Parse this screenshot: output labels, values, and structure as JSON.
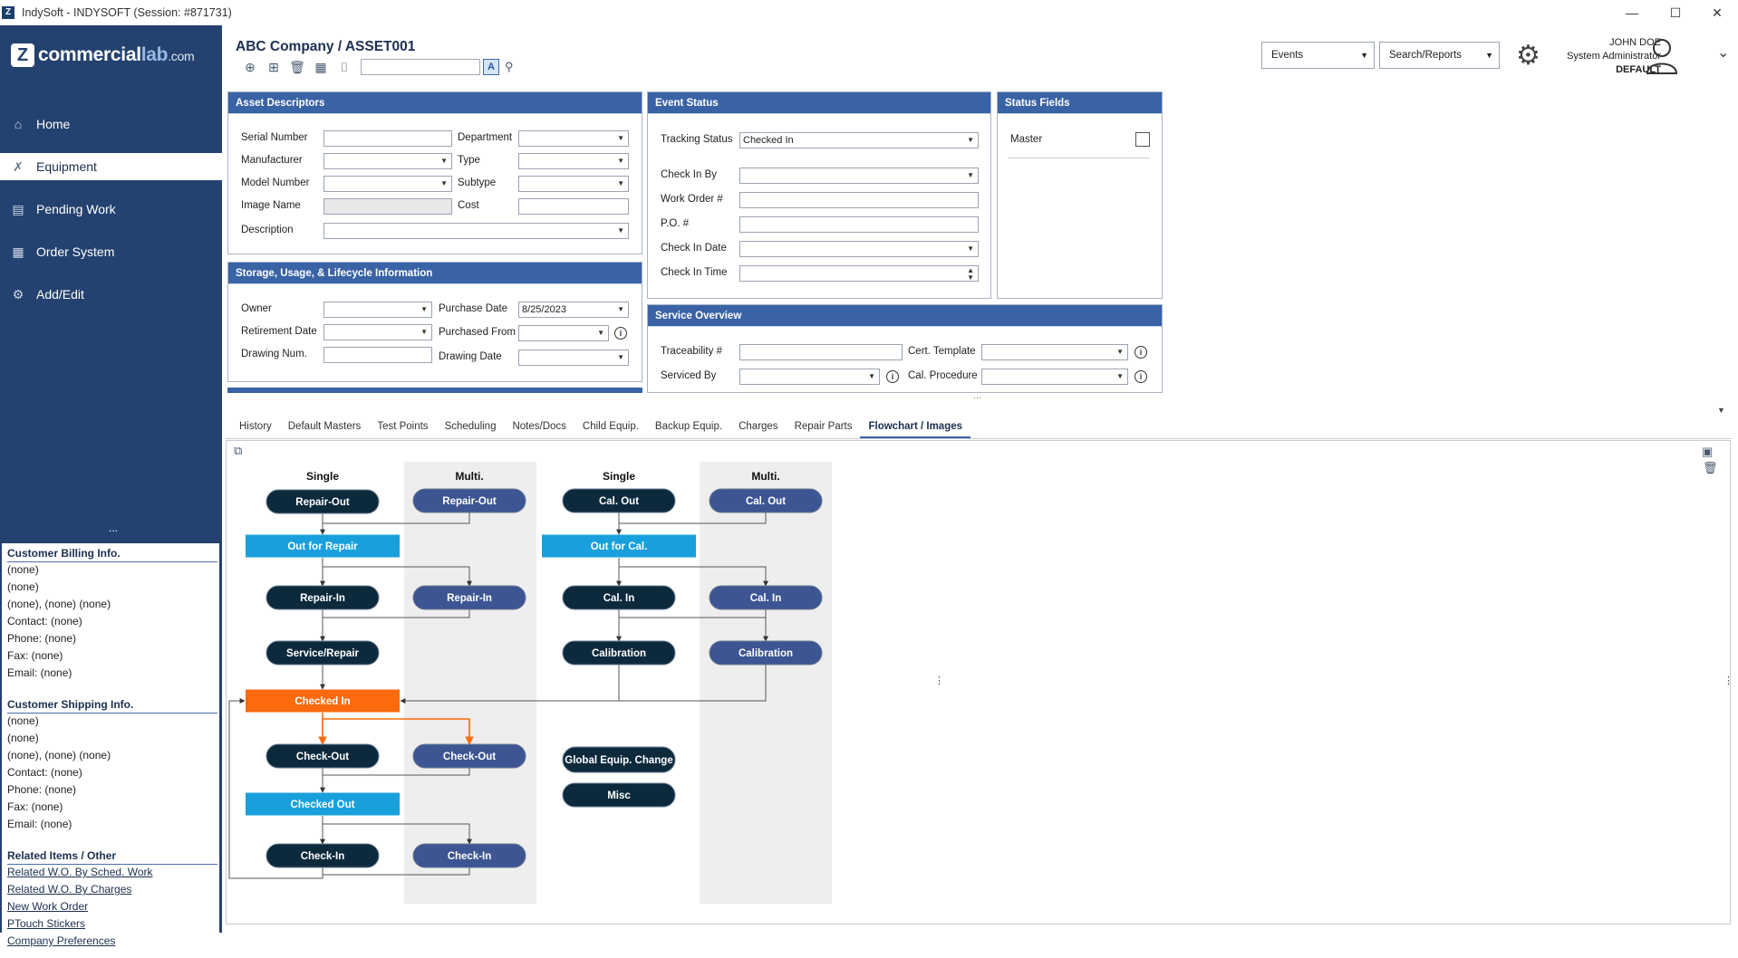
{
  "window": {
    "title": "IndySoft - INDYSOFT (Session: #871731)",
    "minimize": "—",
    "maximize": "☐",
    "close": "✕"
  },
  "brand": {
    "logo_main": "commercial",
    "logo_accent": "lab",
    "logo_suffix": ".com"
  },
  "nav": [
    {
      "label": "Home",
      "icon": "home-icon",
      "glyph": "⌂"
    },
    {
      "label": "Equipment",
      "icon": "tools-icon",
      "glyph": "✗"
    },
    {
      "label": "Pending Work",
      "icon": "clipboard-icon",
      "glyph": "▤"
    },
    {
      "label": "Order System",
      "icon": "calendar-icon",
      "glyph": "▦"
    },
    {
      "label": "Add/Edit",
      "icon": "edit-icon",
      "glyph": "⚙"
    }
  ],
  "side_more": "...",
  "billing": {
    "title": "Customer Billing Info.",
    "lines": [
      "(none)",
      "(none)",
      "(none), (none)  (none)",
      "Contact:  (none)",
      "Phone:  (none)",
      "Fax:  (none)",
      "Email:  (none)"
    ]
  },
  "shipping": {
    "title": "Customer Shipping Info.",
    "lines": [
      "(none)",
      "(none)",
      "(none), (none)  (none)",
      "Contact:  (none)",
      "Phone:  (none)",
      "Fax:  (none)",
      "Email:  (none)"
    ]
  },
  "related": {
    "title": "Related Items / Other",
    "links": [
      "Related W.O. By Sched. Work",
      "Related W.O. By Charges",
      "New Work Order",
      "PTouch Stickers",
      "Company Preferences"
    ]
  },
  "header": {
    "crumb": "ABC Company  /  ASSET001",
    "find_value": "",
    "find_button": "A",
    "events_label": "Events",
    "search_label": "Search/Reports",
    "user_name": "JOHN DOE",
    "user_role": "System Administrator",
    "user_db": "DEFAULT"
  },
  "asset": {
    "title": "Asset Descriptors",
    "serial_label": "Serial Number",
    "serial_value": "",
    "department_label": "Department",
    "manufacturer_label": "Manufacturer",
    "type_label": "Type",
    "model_label": "Model Number",
    "subtype_label": "Subtype",
    "image_label": "Image Name",
    "cost_label": "Cost",
    "description_label": "Description"
  },
  "storage": {
    "title": "Storage, Usage, & Lifecycle Information",
    "owner_label": "Owner",
    "purchase_date_label": "Purchase Date",
    "purchase_date_value": "8/25/2023",
    "retirement_label": "Retirement Date",
    "purchased_from_label": "Purchased From",
    "drawing_num_label": "Drawing Num.",
    "drawing_date_label": "Drawing Date"
  },
  "event": {
    "title": "Event Status",
    "tracking_label": "Tracking Status",
    "tracking_value": "Checked In",
    "checkin_by_label": "Check In By",
    "wo_label": "Work Order #",
    "po_label": "P.O. #",
    "checkin_date_label": "Check In Date",
    "checkin_time_label": "Check In Time"
  },
  "status_fields": {
    "title": "Status Fields",
    "master_label": "Master",
    "master_checked": false
  },
  "service": {
    "title": "Service Overview",
    "traceability_label": "Traceability #",
    "cert_label": "Cert. Template",
    "serviced_by_label": "Serviced By",
    "cal_proc_label": "Cal. Procedure"
  },
  "tabs": [
    {
      "label": "History"
    },
    {
      "label": "Default Masters"
    },
    {
      "label": "Test Points"
    },
    {
      "label": "Scheduling"
    },
    {
      "label": "Notes/Docs"
    },
    {
      "label": "Child Equip."
    },
    {
      "label": "Backup Equip."
    },
    {
      "label": "Charges"
    },
    {
      "label": "Repair Parts"
    },
    {
      "label": "Flowchart / Images",
      "active": true
    }
  ],
  "flow": {
    "colors": {
      "dark": "#0d2a3d",
      "multi": "#3d5593",
      "blue_box": "#17a0dc",
      "orange": "#fb6a0d",
      "col_bg": "#eeeeee"
    },
    "col_headers": [
      "Single",
      "Multi.",
      "Single",
      "Multi."
    ],
    "nodes": {
      "repair_out_s": "Repair-Out",
      "repair_out_m": "Repair-Out",
      "out_for_repair": "Out for Repair",
      "repair_in_s": "Repair-In",
      "repair_in_m": "Repair-In",
      "service_repair": "Service/Repair",
      "checked_in": "Checked In",
      "check_out_s": "Check-Out",
      "check_out_m": "Check-Out",
      "checked_out": "Checked Out",
      "check_in_s": "Check-In",
      "check_in_m": "Check-In",
      "cal_out_s": "Cal. Out",
      "cal_out_m": "Cal. Out",
      "out_for_cal": "Out for Cal.",
      "cal_in_s": "Cal. In",
      "cal_in_m": "Cal. In",
      "calibration_s": "Calibration",
      "calibration_m": "Calibration",
      "global_change": "Global Equip. Change",
      "misc": "Misc"
    }
  }
}
